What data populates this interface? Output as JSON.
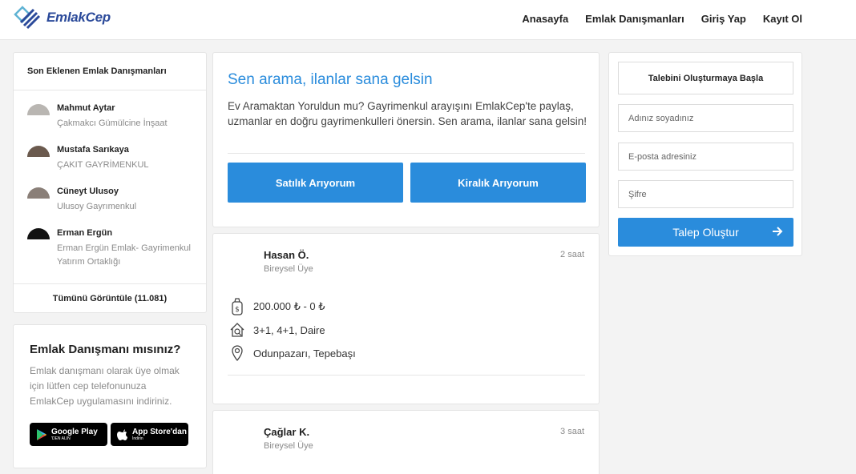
{
  "header": {
    "logo_text": "EmlakCep",
    "nav": [
      "Anasayfa",
      "Emlak Danışmanları",
      "Giriş Yap",
      "Kayıt Ol"
    ]
  },
  "recent_agents": {
    "title": "Son Eklenen Emlak Danışmanları",
    "items": [
      {
        "name": "Mahmut Aytar",
        "company": "Çakmakcı Gümülcine İnşaat"
      },
      {
        "name": "Mustafa Sarıkaya",
        "company": "ÇAKIT GAYRİMENKUL"
      },
      {
        "name": "Cüneyt Ulusoy",
        "company": "Ulusoy Gayrımenkul"
      },
      {
        "name": "Erman Ergün",
        "company": "Erman Ergün Emlak- Gayrimenkul Yatırım Ortaklığı"
      }
    ],
    "view_all": "Tümünü Görüntüle (11.081)"
  },
  "promo": {
    "title": "Emlak Danışmanı mısınız?",
    "text": "Emlak danışmanı olarak üye olmak için lütfen cep telefonunuza EmlakCep uygulamasını indiriniz.",
    "google_play_big": "Google Play",
    "google_play_small": "'DEN ALIN",
    "app_store_big": "App Store'dan",
    "app_store_small": "İndirin"
  },
  "hero": {
    "title": "Sen arama, ilanlar sana gelsin",
    "text": "Ev Aramaktan Yoruldun mu? Gayrimenkul arayışını EmlakCep'te paylaş, uzmanlar en doğru gayrimenkulleri önersin. Sen arama, ilanlar sana gelsin!",
    "buy_button": "Satılık Arıyorum",
    "rent_button": "Kiralık Arıyorum"
  },
  "listings": [
    {
      "name": "Hasan Ö.",
      "type": "Bireysel Üye",
      "time": "2 saat",
      "price": "200.000 ₺ - 0 ₺",
      "rooms": "3+1, 4+1, Daire",
      "location": "Odunpazarı, Tepebaşı"
    },
    {
      "name": "Çağlar K.",
      "type": "Bireysel Üye",
      "time": "3 saat"
    }
  ],
  "request_form": {
    "heading": "Talebini Oluşturmaya Başla",
    "name_placeholder": "Adınız soyadınız",
    "email_placeholder": "E-posta adresiniz",
    "password_placeholder": "Şifre",
    "submit": "Talep Oluştur"
  },
  "colors": {
    "accent": "#2a8cdc",
    "brand": "#2b4a9a"
  }
}
